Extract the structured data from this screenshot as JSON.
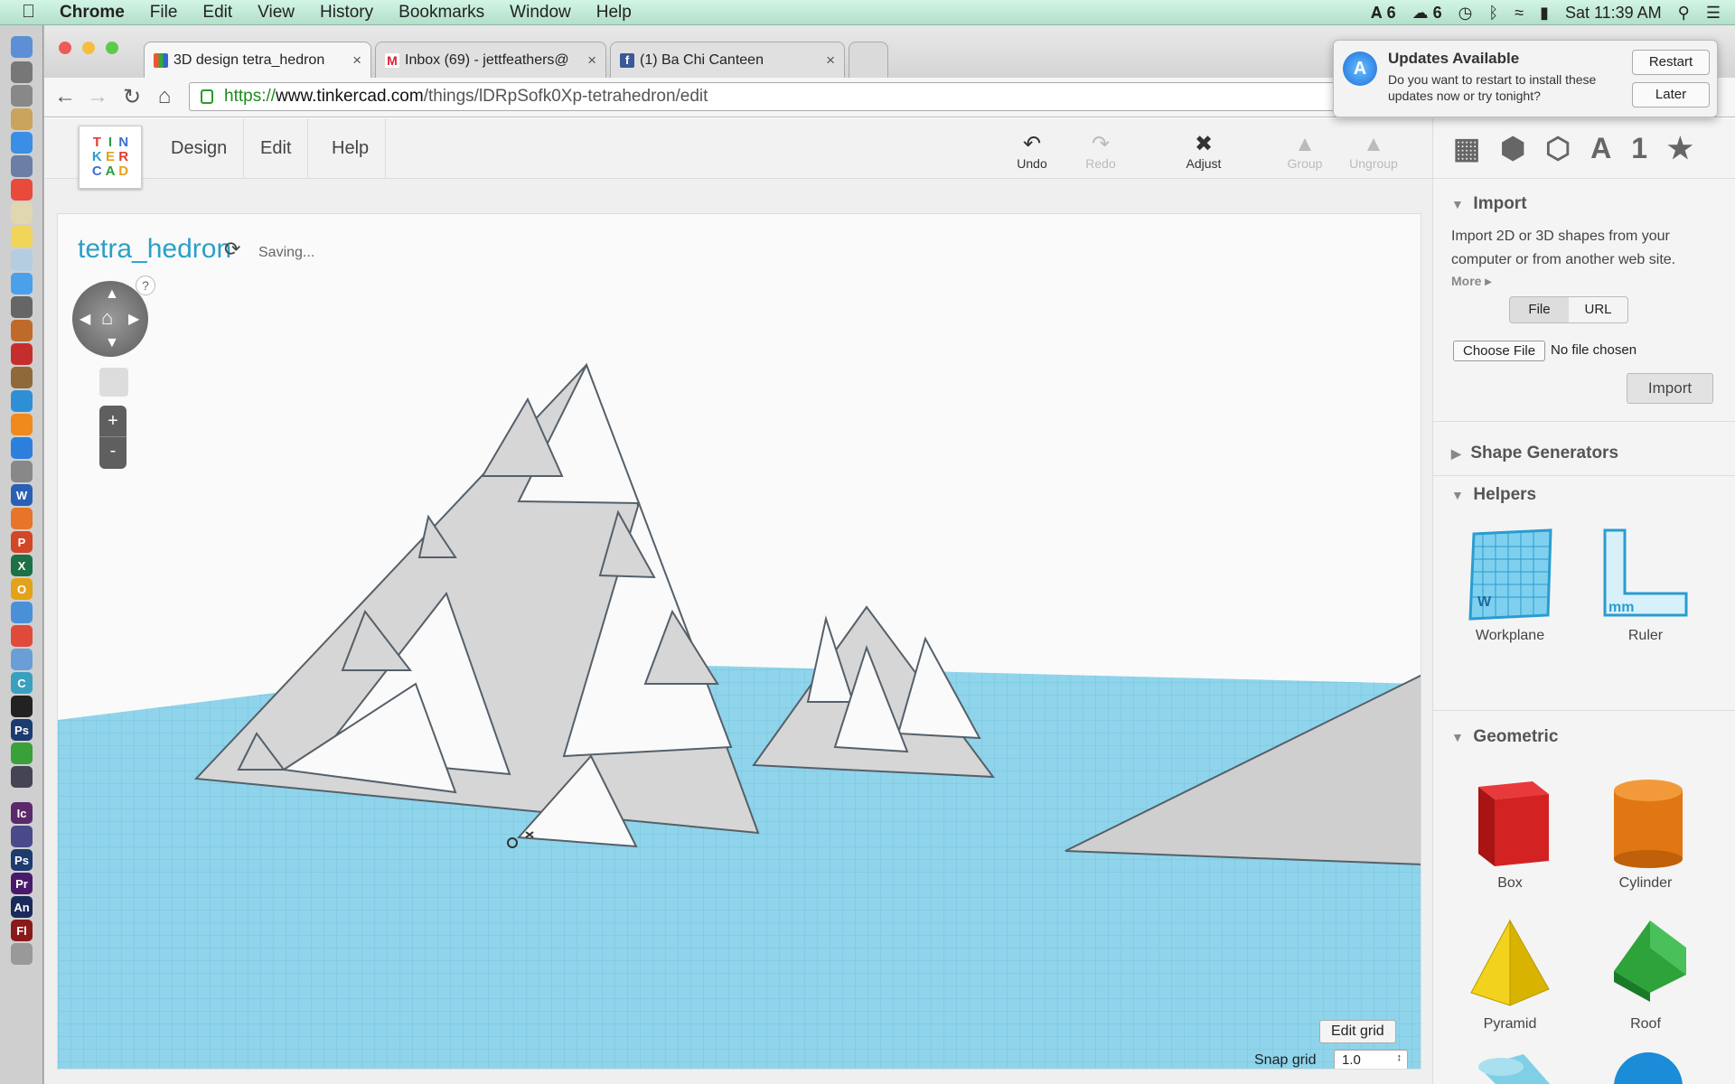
{
  "menubar": {
    "app_name": "Chrome",
    "items": [
      "File",
      "Edit",
      "View",
      "History",
      "Bookmarks",
      "Window",
      "Help"
    ],
    "status": {
      "adobe_count": "6",
      "cc_count": "6",
      "clock": "Sat 11:39 AM"
    }
  },
  "browser": {
    "tabs": [
      {
        "title": "3D design tetra_hedron",
        "favicon": "tinkercad-icon",
        "active": true
      },
      {
        "title": "Inbox (69) - jettfeathers@",
        "favicon": "gmail-icon",
        "active": false
      },
      {
        "title": "(1) Ba Chi Canteen",
        "favicon": "facebook-icon",
        "active": false
      }
    ],
    "url": {
      "scheme": "https://",
      "host": "www.tinkercad.com",
      "path": "/things/lDRpSofk0Xp-tetrahedron/edit"
    }
  },
  "tinkercad": {
    "logo": [
      "T",
      "I",
      "N",
      "K",
      "E",
      "R",
      "C",
      "A",
      "D"
    ],
    "menu": [
      "Design",
      "Edit",
      "Help"
    ],
    "tools": [
      {
        "label": "Undo",
        "icon": "undo-icon",
        "enabled": true
      },
      {
        "label": "Redo",
        "icon": "redo-icon",
        "enabled": false
      },
      {
        "label": "Adjust",
        "icon": "adjust-icon",
        "enabled": true
      },
      {
        "label": "Group",
        "icon": "group-icon",
        "enabled": false
      },
      {
        "label": "Ungroup",
        "icon": "ungroup-icon",
        "enabled": false
      }
    ],
    "design_title": "tetra_hedron",
    "save_status": "Saving...",
    "help_mark": "?",
    "zoom_in": "+",
    "zoom_out": "-",
    "edit_grid": "Edit grid",
    "snap_grid_label": "Snap grid",
    "snap_grid_value": "1.0"
  },
  "sidebar": {
    "top_icons": [
      "workplane-grid-icon",
      "box-3d-icon",
      "wireframe-box-icon",
      "letter-a-icon",
      "number-one-icon",
      "star-icon"
    ],
    "top_glyphs": {
      "letter": "A",
      "number": "1"
    },
    "import": {
      "heading": "Import",
      "description": "Import 2D or 3D shapes from your computer or from another web site.",
      "more": "More",
      "toggle": [
        "File",
        "URL"
      ],
      "choose_file": "Choose File",
      "no_file": "No file chosen",
      "button": "Import"
    },
    "shape_generators": "Shape Generators",
    "helpers": {
      "heading": "Helpers",
      "items": [
        "Workplane",
        "Ruler"
      ]
    },
    "geometric": {
      "heading": "Geometric",
      "items": [
        "Box",
        "Cylinder",
        "Pyramid",
        "Roof"
      ]
    }
  },
  "notification": {
    "title": "Updates Available",
    "body": "Do you want to restart to install these updates now or try tonight?",
    "restart": "Restart",
    "later": "Later"
  },
  "colors": {
    "accent": "#2aa0c8",
    "workplane": "#7fcfe6",
    "box": "#d32222",
    "cylinder": "#e07712",
    "pyramid": "#f2d21c",
    "roof": "#2da33a"
  }
}
